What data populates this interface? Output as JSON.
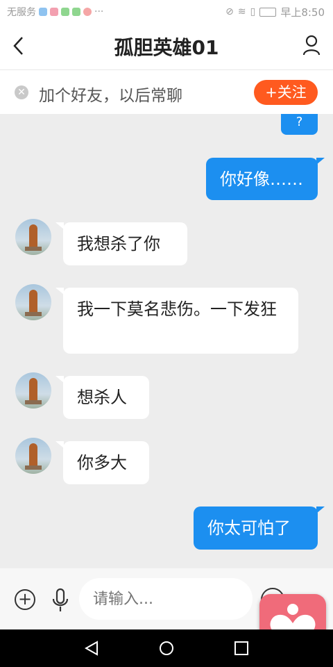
{
  "status": {
    "carrier": "无服务",
    "time": "早上8:50"
  },
  "header": {
    "title": "孤胆英雄01"
  },
  "banner": {
    "text": "加个好友，以后常聊",
    "follow_label": "+关注"
  },
  "messages": [
    {
      "side": "out",
      "text": "?"
    },
    {
      "side": "out",
      "text": "你好像……"
    },
    {
      "side": "in",
      "text": "我想杀了你"
    },
    {
      "side": "in",
      "text": "我一下莫名悲伤。一下发狂"
    },
    {
      "side": "in",
      "text": "想杀人"
    },
    {
      "side": "in",
      "text": "你多大"
    },
    {
      "side": "out",
      "text": "你太可怕了"
    }
  ],
  "composer": {
    "placeholder": "请输入..."
  },
  "colors": {
    "outgoing_bubble": "#1c8ff0",
    "follow_button": "#ff5a1f",
    "float_button": "#f06b7a"
  }
}
